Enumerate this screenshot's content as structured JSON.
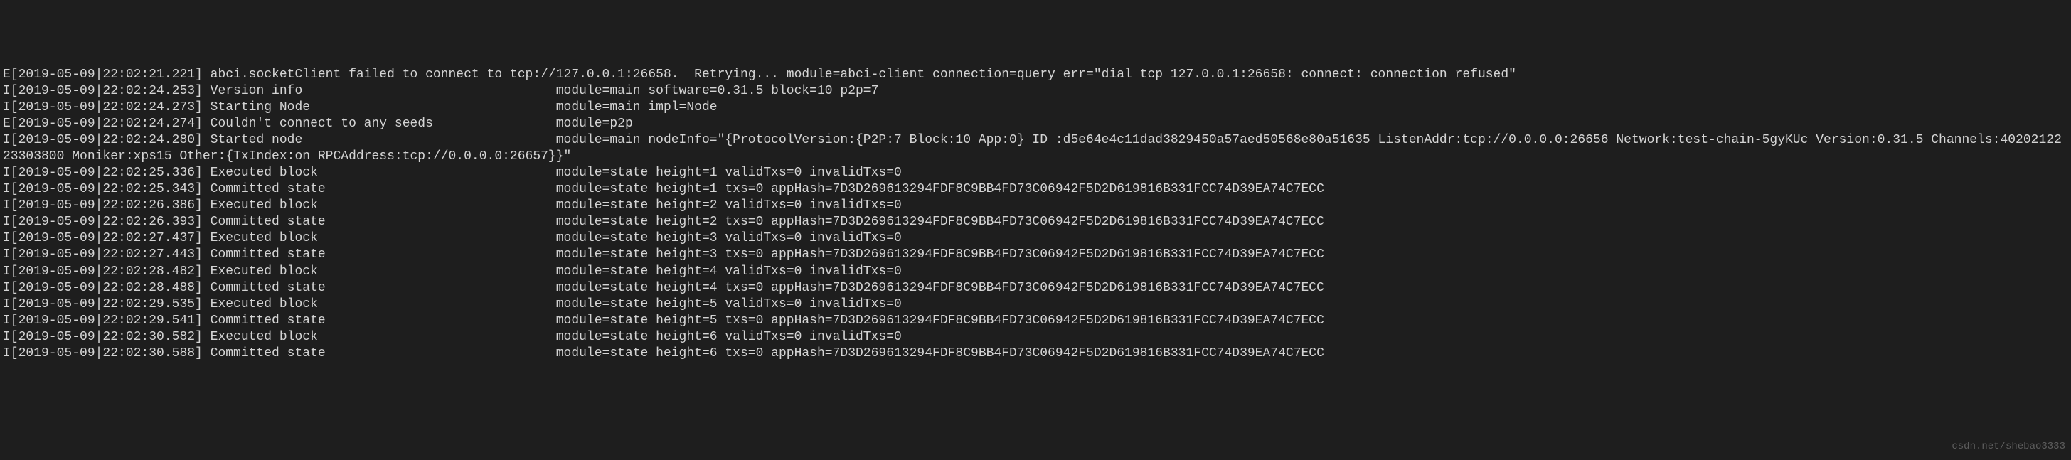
{
  "watermark": "csdn.net/shebao3333",
  "lines": [
    "E[2019-05-09|22:02:21.221] abci.socketClient failed to connect to tcp://127.0.0.1:26658.  Retrying... module=abci-client connection=query err=\"dial tcp 127.0.0.1:26658: connect: connection refused\"",
    "I[2019-05-09|22:02:24.253] Version info                                 module=main software=0.31.5 block=10 p2p=7",
    "I[2019-05-09|22:02:24.273] Starting Node                                module=main impl=Node",
    "E[2019-05-09|22:02:24.274] Couldn't connect to any seeds                module=p2p ",
    "I[2019-05-09|22:02:24.280] Started node                                 module=main nodeInfo=\"{ProtocolVersion:{P2P:7 Block:10 App:0} ID_:d5e64e4c11dad3829450a57aed50568e80a51635 ListenAddr:tcp://0.0.0.0:26656 Network:test-chain-5gyKUc Version:0.31.5 Channels:4020212223303800 Moniker:xps15 Other:{TxIndex:on RPCAddress:tcp://0.0.0.0:26657}}\"",
    "I[2019-05-09|22:02:25.336] Executed block                               module=state height=1 validTxs=0 invalidTxs=0",
    "I[2019-05-09|22:02:25.343] Committed state                              module=state height=1 txs=0 appHash=7D3D269613294FDF8C9BB4FD73C06942F5D2D619816B331FCC74D39EA74C7ECC",
    "I[2019-05-09|22:02:26.386] Executed block                               module=state height=2 validTxs=0 invalidTxs=0",
    "I[2019-05-09|22:02:26.393] Committed state                              module=state height=2 txs=0 appHash=7D3D269613294FDF8C9BB4FD73C06942F5D2D619816B331FCC74D39EA74C7ECC",
    "I[2019-05-09|22:02:27.437] Executed block                               module=state height=3 validTxs=0 invalidTxs=0",
    "I[2019-05-09|22:02:27.443] Committed state                              module=state height=3 txs=0 appHash=7D3D269613294FDF8C9BB4FD73C06942F5D2D619816B331FCC74D39EA74C7ECC",
    "I[2019-05-09|22:02:28.482] Executed block                               module=state height=4 validTxs=0 invalidTxs=0",
    "I[2019-05-09|22:02:28.488] Committed state                              module=state height=4 txs=0 appHash=7D3D269613294FDF8C9BB4FD73C06942F5D2D619816B331FCC74D39EA74C7ECC",
    "I[2019-05-09|22:02:29.535] Executed block                               module=state height=5 validTxs=0 invalidTxs=0",
    "I[2019-05-09|22:02:29.541] Committed state                              module=state height=5 txs=0 appHash=7D3D269613294FDF8C9BB4FD73C06942F5D2D619816B331FCC74D39EA74C7ECC",
    "I[2019-05-09|22:02:30.582] Executed block                               module=state height=6 validTxs=0 invalidTxs=0",
    "I[2019-05-09|22:02:30.588] Committed state                              module=state height=6 txs=0 appHash=7D3D269613294FDF8C9BB4FD73C06942F5D2D619816B331FCC74D39EA74C7ECC"
  ]
}
